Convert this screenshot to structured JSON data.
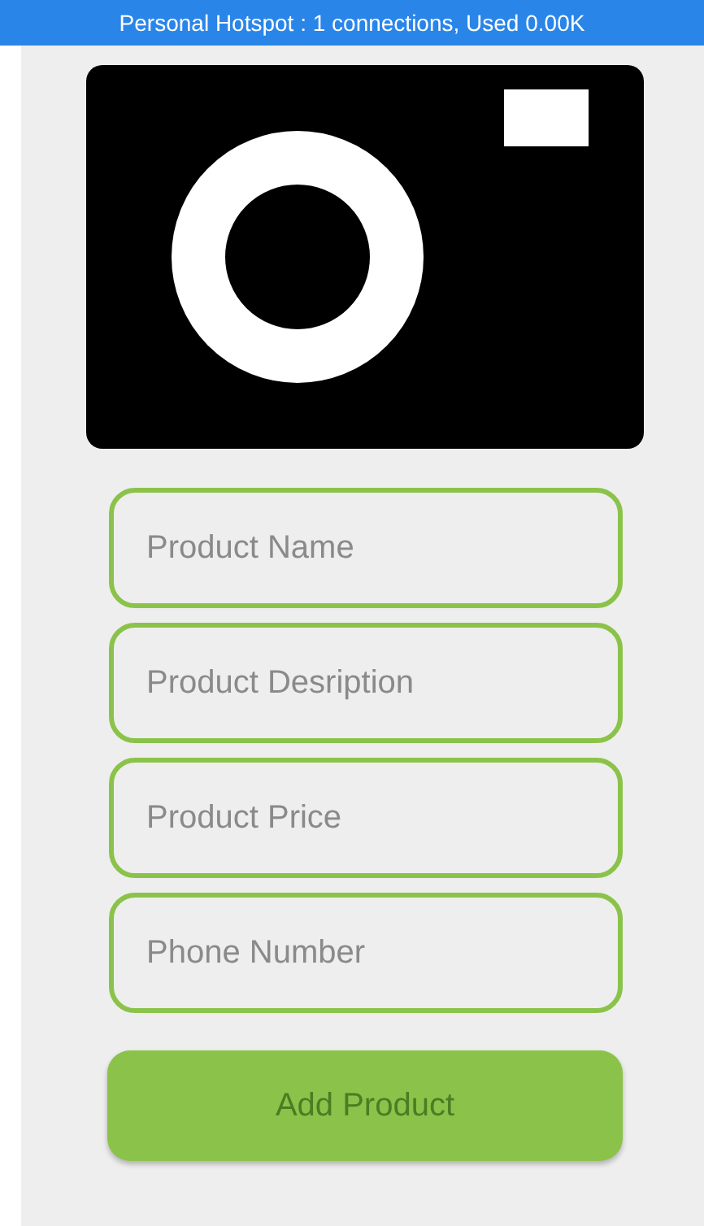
{
  "status_bar": {
    "text": "Personal Hotspot : 1 connections, Used 0.00K"
  },
  "fields": [
    {
      "placeholder": "Product Name"
    },
    {
      "placeholder": "Product Desription"
    },
    {
      "placeholder": "Product Price"
    },
    {
      "placeholder": "Phone Number"
    }
  ],
  "button": {
    "label": "Add Product"
  }
}
